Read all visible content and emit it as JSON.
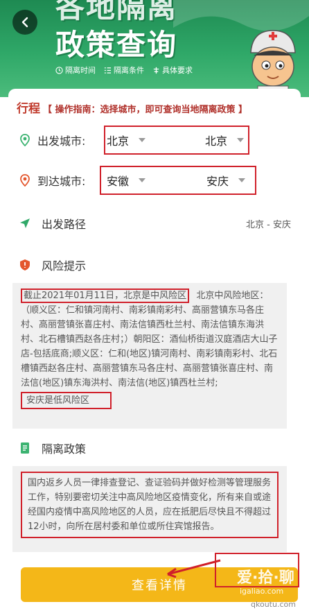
{
  "banner": {
    "title_line1": "各地隔离",
    "title_line2": "政策查询",
    "features": [
      {
        "icon": "clock-icon",
        "label": "隔离时间"
      },
      {
        "icon": "list-icon",
        "label": "隔离条件"
      },
      {
        "icon": "requirements-icon",
        "label": "具体要求"
      }
    ]
  },
  "guide": {
    "tag": "行程",
    "text": "【 操作指南：选择城市，即可查询当地隔离政策 】"
  },
  "departure": {
    "label": "出发城市:",
    "province": "北京",
    "city": "北京"
  },
  "arrival": {
    "label": "到达城市:",
    "province": "安徽",
    "city": "安庆"
  },
  "route": {
    "label": "出发路径",
    "value": "北京 - 安庆"
  },
  "risk": {
    "label": "风险提示",
    "highlight": "截止2021年01月11日，北京是中风险区",
    "body": "北京中风险地区：（顺义区：仁和镇河南村、南彩镇南彩村、高丽营镇东马各庄村、高丽营镇张喜庄村、南法信镇西杜兰村、南法信镇东海洪村、北石槽镇西赵各庄村；）朝阳区：酒仙桥街道汉庭酒店大山子店-包括底商;顺义区：仁和(地区)镇河南村、南彩镇南彩村、北石槽镇西赵各庄村、高丽营镇东马各庄村、高丽营镇张喜庄村、南法信(地区)镇东海洪村、南法信(地区)镇西杜兰村;",
    "footer": "安庆是低风险区"
  },
  "quarantine": {
    "label": "隔离政策",
    "text": "国内返乡人员一律排查登记、查证验码并做好检测等管理服务工作，特别要密切关注中高风险地区疫情变化，所有来自或途经国内疫情中高风险地区的人员，应在抵肥后尽快且不得超过12小时，向所在居村委和单位或所住宾馆报告。"
  },
  "details_button": "查看详情",
  "watermark": {
    "line1": "爱·拾·聊",
    "line2": "igaliao.com",
    "line3": "qkoutu.com"
  },
  "colors": {
    "banner_green": "#2fa868",
    "highlight_red": "#d0202a",
    "button_yellow": "#f4b718"
  }
}
